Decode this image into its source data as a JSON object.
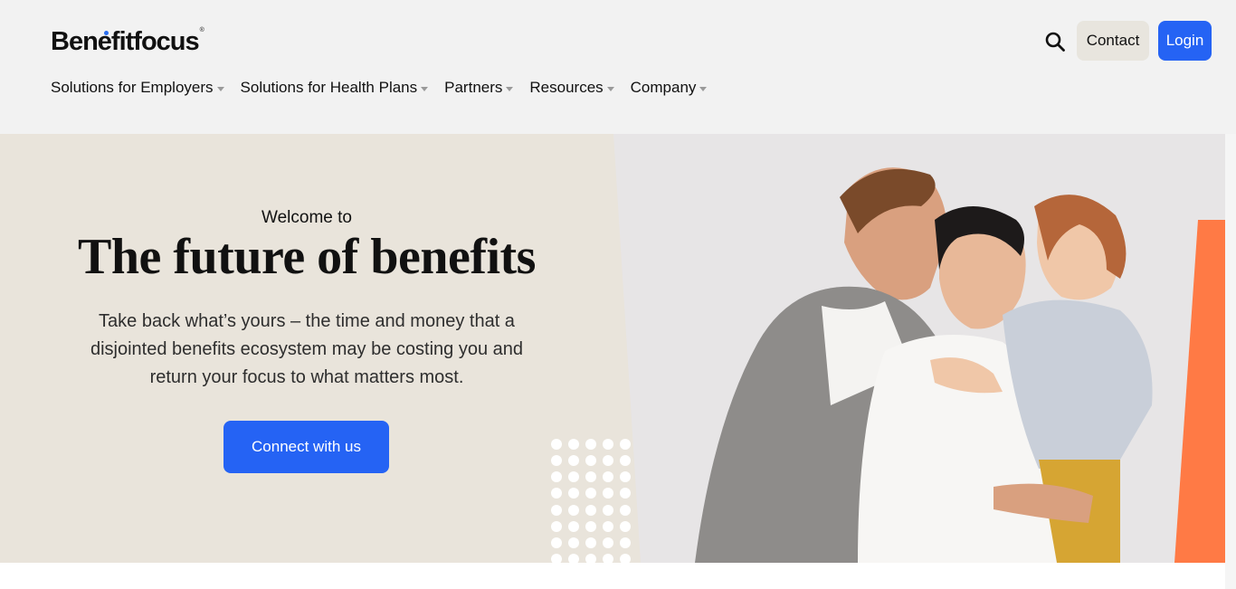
{
  "header": {
    "logo": "Benefitfocus",
    "logo_mark": "®",
    "nav": [
      {
        "label": "Solutions for Employers"
      },
      {
        "label": "Solutions for Health Plans"
      },
      {
        "label": "Partners"
      },
      {
        "label": "Resources"
      },
      {
        "label": "Company"
      }
    ],
    "search_icon": "search-icon",
    "contact_label": "Contact",
    "login_label": "Login"
  },
  "hero": {
    "eyebrow": "Welcome to",
    "headline": "The future of benefits",
    "subtext": "Take back what’s yours – the time and money that a disjointed benefits ecosystem may be costing you and return your focus to what matters most.",
    "cta_label": "Connect with us"
  },
  "colors": {
    "brand_blue": "#2563f4",
    "hero_bg": "#e9e4db",
    "accent_orange": "#ff7a45",
    "header_bg": "#f2f2f2"
  }
}
